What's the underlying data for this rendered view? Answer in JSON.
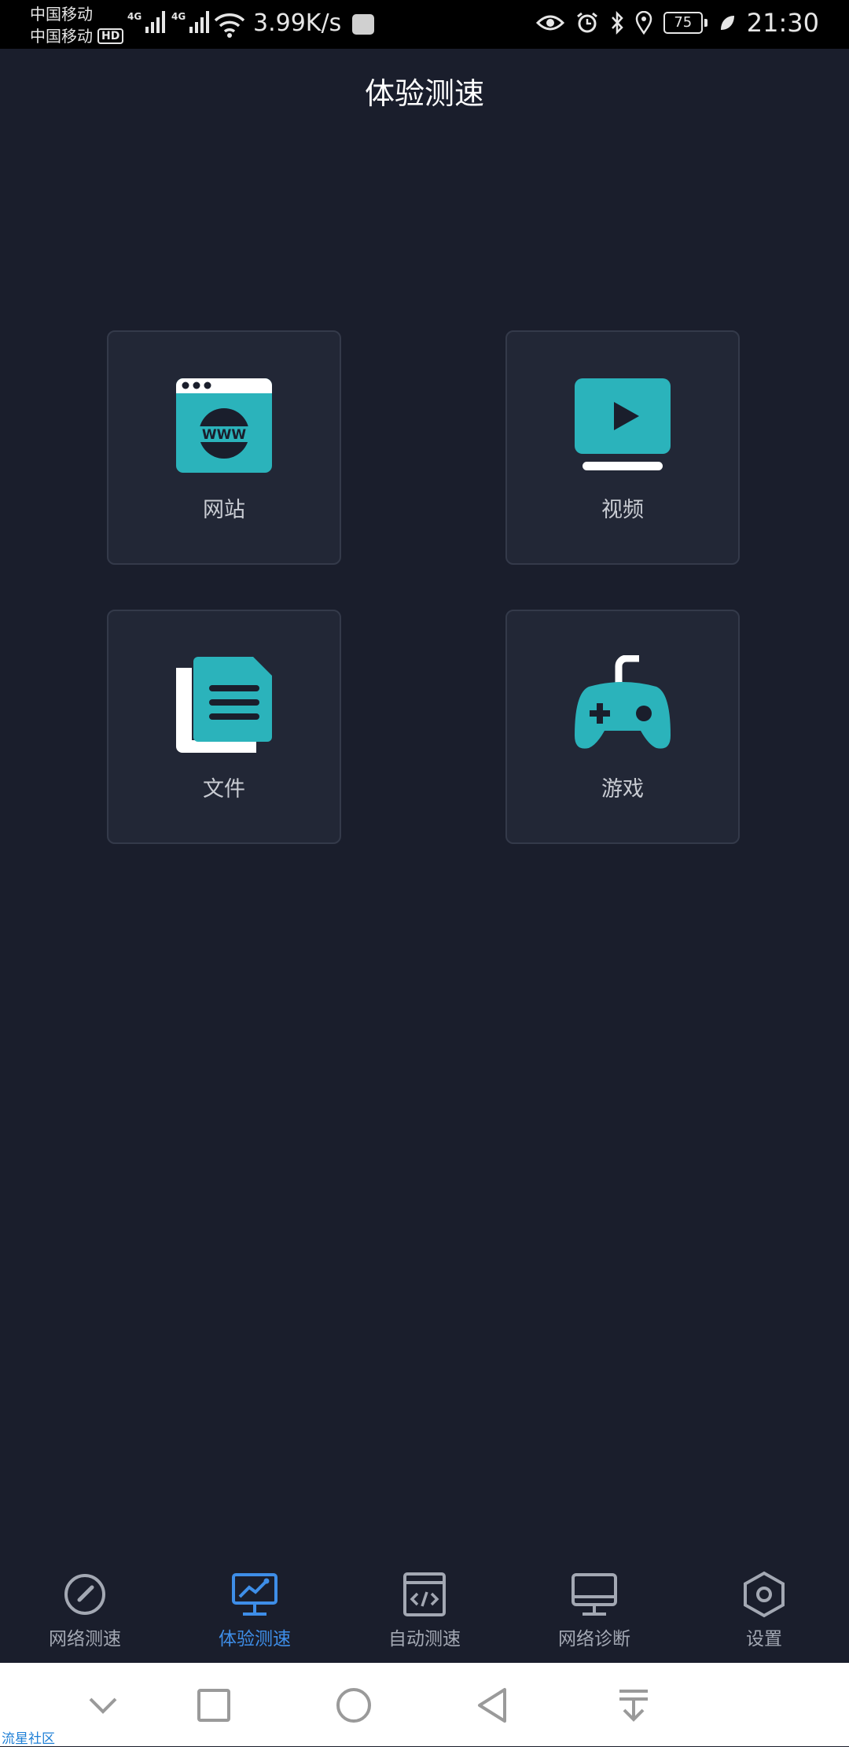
{
  "status_bar": {
    "carrier_1": "中国移动",
    "carrier_2": "中国移动",
    "hd_badge": "HD",
    "network_1": "4G",
    "network_2": "4G",
    "net_speed": "3.99K/s",
    "battery": "75",
    "time": "21:30"
  },
  "header": {
    "title": "体验测速"
  },
  "cards": [
    {
      "label": "网站",
      "icon": "website-www-icon"
    },
    {
      "label": "视频",
      "icon": "video-play-icon"
    },
    {
      "label": "文件",
      "icon": "file-document-icon"
    },
    {
      "label": "游戏",
      "icon": "gamepad-icon"
    }
  ],
  "www_text": "WWW",
  "tabs": [
    {
      "label": "网络测速",
      "icon": "speedometer-icon",
      "active": false
    },
    {
      "label": "体验测速",
      "icon": "monitor-chart-icon",
      "active": true
    },
    {
      "label": "自动测速",
      "icon": "code-window-icon",
      "active": false
    },
    {
      "label": "网络诊断",
      "icon": "desktop-monitor-icon",
      "active": false
    },
    {
      "label": "设置",
      "icon": "gear-hexagon-icon",
      "active": false
    }
  ],
  "watermark": "流星社区",
  "colors": {
    "background": "#1a1e2c",
    "card": "#222736",
    "accent_teal": "#2bb3bb",
    "active_tab": "#3e8ee8",
    "inactive_tab": "#a3a8b3"
  }
}
